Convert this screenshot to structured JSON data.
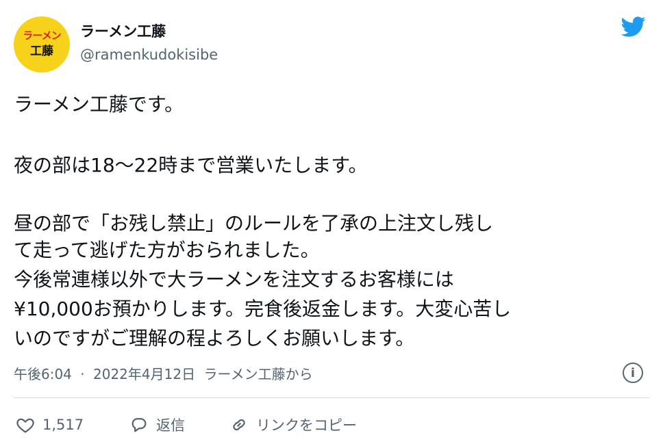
{
  "author": {
    "avatar_text_top": "ラーメン",
    "avatar_text_bottom": "工藤",
    "display_name": "ラーメン工藤",
    "handle": "@ramenkudokisibe"
  },
  "tweet": {
    "lines": [
      "ラーメン工藤です。",
      "夜の部は18〜22時まで営業いたします。",
      "昼の部で「お残し禁止」のルールを了承の上注文し残し",
      "て走って逃げた方がおられました。",
      "今後常連様以外で大ラーメンを注文するお客様には",
      "¥10,000お預かりします。完食後返金します。大変心苦し",
      "いのですがご理解の程よろしくお願いします。"
    ]
  },
  "meta": {
    "time": "午後6:04",
    "separator": "·",
    "date": "2022年4月12日",
    "source": "ラーメン工藤から",
    "info_symbol": "i"
  },
  "actions": {
    "like_count": "1,517",
    "reply_label": "返信",
    "copy_link_label": "リンクをコピー"
  },
  "icons": {
    "brand": "twitter-bird-icon",
    "info": "info-icon",
    "like": "heart-icon",
    "reply": "speech-bubble-icon",
    "link": "link-icon"
  },
  "colors": {
    "brand_blue": "#1d9bf0",
    "secondary_text": "#536471",
    "avatar_background": "#f7d21a",
    "avatar_accent": "#d9261c"
  }
}
